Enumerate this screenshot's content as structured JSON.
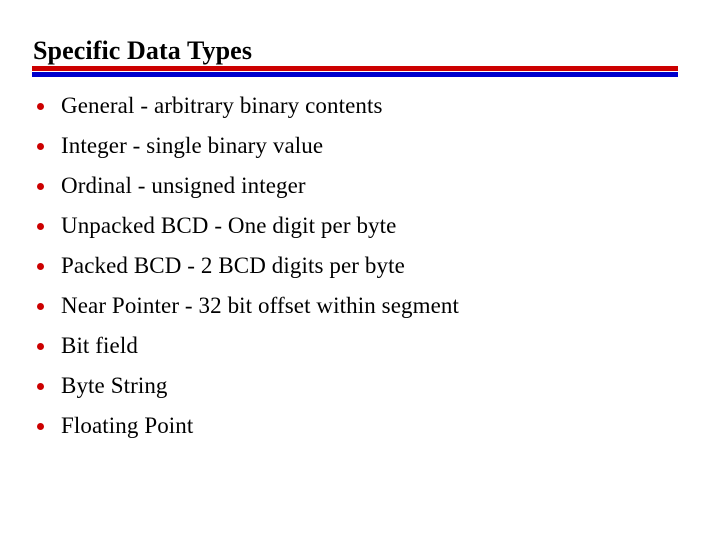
{
  "slide": {
    "title": "Specific Data Types",
    "background_color": "#ffffff",
    "title_color": "#000000",
    "divider": {
      "top_rule_color": "#cc0000",
      "bottom_rule_color": "#0000cc"
    },
    "bullets": {
      "marker_icon": "bullet-dot-icon",
      "marker_color": "#cc0000",
      "text_color": "#000000",
      "items": [
        {
          "text": "General - arbitrary binary contents"
        },
        {
          "text": "Integer - single binary value"
        },
        {
          "text": "Ordinal - unsigned integer"
        },
        {
          "text": "Unpacked BCD - One digit per byte"
        },
        {
          "text": "Packed BCD - 2 BCD digits per byte"
        },
        {
          "text": "Near Pointer - 32 bit offset within segment"
        },
        {
          "text": "Bit field"
        },
        {
          "text": "Byte String"
        },
        {
          "text": "Floating Point"
        }
      ]
    }
  }
}
